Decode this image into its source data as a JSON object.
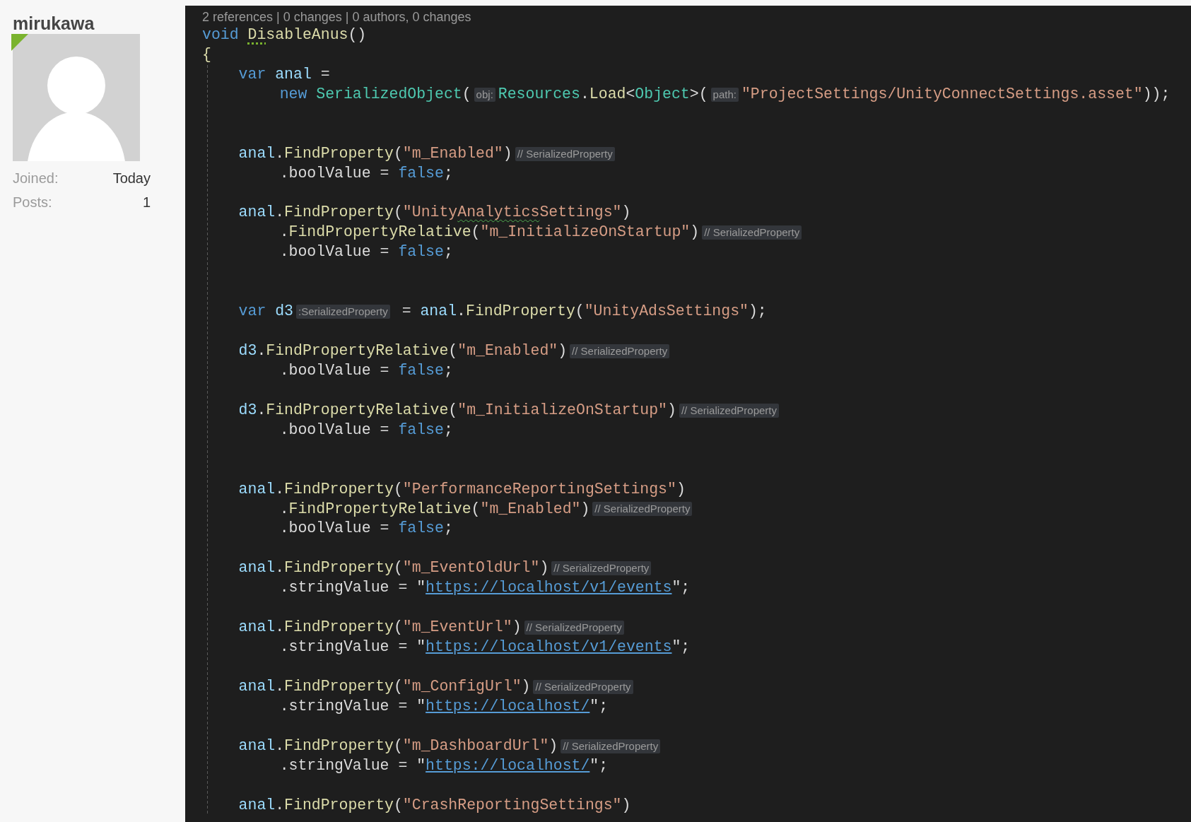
{
  "user": {
    "name": "mirukawa",
    "online": true,
    "stats": [
      {
        "label": "Joined:",
        "value": "Today"
      },
      {
        "label": "Posts:",
        "value": "1"
      }
    ]
  },
  "code": {
    "codelens": "2 references | 0 changes | 0 authors, 0 changes",
    "lines": [
      {
        "kind": "top",
        "segments": [
          {
            "kind": "code",
            "tokens": [
              {
                "kind": "keyword",
                "text": "void "
              },
              {
                "kind": "method",
                "text": "Di",
                "suggestion": true
              },
              {
                "kind": "method",
                "text": "sableAnus"
              },
              {
                "kind": "punct",
                "text": "()"
              }
            ]
          }
        ]
      },
      {
        "kind": "top",
        "segments": [
          {
            "kind": "code",
            "tokens": [
              {
                "kind": "method",
                "text": "{"
              }
            ]
          }
        ]
      },
      {
        "kind": "statement",
        "segments": [
          {
            "kind": "code",
            "tokens": [
              {
                "kind": "keyword",
                "text": "var "
              },
              {
                "kind": "variable",
                "text": "anal"
              },
              {
                "kind": "punct",
                "text": " ="
              }
            ]
          }
        ]
      },
      {
        "kind": "continuation",
        "segments": [
          {
            "kind": "code",
            "tokens": [
              {
                "kind": "keyword",
                "text": "new "
              },
              {
                "kind": "type",
                "text": "SerializedObject"
              },
              {
                "kind": "punct",
                "text": "("
              }
            ]
          },
          {
            "kind": "hint",
            "text": "obj:"
          },
          {
            "kind": "code",
            "tokens": [
              {
                "kind": "type",
                "text": "Resources"
              },
              {
                "kind": "punct",
                "text": "."
              },
              {
                "kind": "method",
                "text": "Load"
              },
              {
                "kind": "punct",
                "text": "<"
              },
              {
                "kind": "type",
                "text": "Object"
              },
              {
                "kind": "punct",
                "text": ">("
              }
            ]
          },
          {
            "kind": "hint",
            "text": "path:"
          },
          {
            "kind": "code",
            "tokens": [
              {
                "kind": "string",
                "text": "\"ProjectSettings/UnityConnectSettings.asset\""
              },
              {
                "kind": "punct",
                "text": "));"
              }
            ]
          }
        ]
      },
      {
        "kind": "blank"
      },
      {
        "kind": "blank"
      },
      {
        "kind": "statement",
        "segments": [
          {
            "kind": "code",
            "tokens": [
              {
                "kind": "variable",
                "text": "anal"
              },
              {
                "kind": "punct",
                "text": "."
              },
              {
                "kind": "method",
                "text": "FindProperty"
              },
              {
                "kind": "punct",
                "text": "("
              },
              {
                "kind": "string",
                "text": "\"m_Enabled\""
              },
              {
                "kind": "punct",
                "text": ")"
              }
            ]
          },
          {
            "kind": "hint",
            "text": "// SerializedProperty"
          }
        ]
      },
      {
        "kind": "continuation",
        "segments": [
          {
            "kind": "code",
            "tokens": [
              {
                "kind": "punct",
                "text": ".boolValue = "
              },
              {
                "kind": "keyword",
                "text": "false"
              },
              {
                "kind": "punct",
                "text": ";"
              }
            ]
          }
        ]
      },
      {
        "kind": "blank"
      },
      {
        "kind": "statement",
        "segments": [
          {
            "kind": "code",
            "tokens": [
              {
                "kind": "variable",
                "text": "anal"
              },
              {
                "kind": "punct",
                "text": "."
              },
              {
                "kind": "method",
                "text": "FindProperty"
              },
              {
                "kind": "punct",
                "text": "("
              },
              {
                "kind": "string",
                "text": "\"Unity"
              },
              {
                "kind": "string",
                "text": "Analytics",
                "warning": true
              },
              {
                "kind": "string",
                "text": "Settings\""
              },
              {
                "kind": "punct",
                "text": ")"
              }
            ]
          }
        ]
      },
      {
        "kind": "continuation",
        "segments": [
          {
            "kind": "code",
            "tokens": [
              {
                "kind": "punct",
                "text": "."
              },
              {
                "kind": "method",
                "text": "FindPropertyRelative"
              },
              {
                "kind": "punct",
                "text": "("
              },
              {
                "kind": "string",
                "text": "\"m_InitializeOnStartup\""
              },
              {
                "kind": "punct",
                "text": ")"
              }
            ]
          },
          {
            "kind": "hint",
            "text": "// SerializedProperty"
          }
        ]
      },
      {
        "kind": "continuation",
        "segments": [
          {
            "kind": "code",
            "tokens": [
              {
                "kind": "punct",
                "text": ".boolValue = "
              },
              {
                "kind": "keyword",
                "text": "false"
              },
              {
                "kind": "punct",
                "text": ";"
              }
            ]
          }
        ]
      },
      {
        "kind": "blank"
      },
      {
        "kind": "blank"
      },
      {
        "kind": "statement",
        "segments": [
          {
            "kind": "code",
            "tokens": [
              {
                "kind": "keyword",
                "text": "var "
              },
              {
                "kind": "variable",
                "text": "d3"
              }
            ]
          },
          {
            "kind": "hint",
            "text": ":SerializedProperty"
          },
          {
            "kind": "code",
            "tokens": [
              {
                "kind": "punct",
                "text": " = "
              },
              {
                "kind": "variable",
                "text": "anal"
              },
              {
                "kind": "punct",
                "text": "."
              },
              {
                "kind": "method",
                "text": "FindProperty"
              },
              {
                "kind": "punct",
                "text": "("
              },
              {
                "kind": "string",
                "text": "\"UnityAdsSettings\""
              },
              {
                "kind": "punct",
                "text": ");"
              }
            ]
          }
        ]
      },
      {
        "kind": "blank"
      },
      {
        "kind": "statement",
        "segments": [
          {
            "kind": "code",
            "tokens": [
              {
                "kind": "variable",
                "text": "d3"
              },
              {
                "kind": "punct",
                "text": "."
              },
              {
                "kind": "method",
                "text": "FindPropertyRelative"
              },
              {
                "kind": "punct",
                "text": "("
              },
              {
                "kind": "string",
                "text": "\"m_Enabled\""
              },
              {
                "kind": "punct",
                "text": ")"
              }
            ]
          },
          {
            "kind": "hint",
            "text": "// SerializedProperty"
          }
        ]
      },
      {
        "kind": "continuation",
        "segments": [
          {
            "kind": "code",
            "tokens": [
              {
                "kind": "punct",
                "text": ".boolValue = "
              },
              {
                "kind": "keyword",
                "text": "false"
              },
              {
                "kind": "punct",
                "text": ";"
              }
            ]
          }
        ]
      },
      {
        "kind": "blank"
      },
      {
        "kind": "statement",
        "segments": [
          {
            "kind": "code",
            "tokens": [
              {
                "kind": "variable",
                "text": "d3"
              },
              {
                "kind": "punct",
                "text": "."
              },
              {
                "kind": "method",
                "text": "FindPropertyRelative"
              },
              {
                "kind": "punct",
                "text": "("
              },
              {
                "kind": "string",
                "text": "\"m_InitializeOnStartup\""
              },
              {
                "kind": "punct",
                "text": ")"
              }
            ]
          },
          {
            "kind": "hint",
            "text": "// SerializedProperty"
          }
        ]
      },
      {
        "kind": "continuation",
        "segments": [
          {
            "kind": "code",
            "tokens": [
              {
                "kind": "punct",
                "text": ".boolValue = "
              },
              {
                "kind": "keyword",
                "text": "false"
              },
              {
                "kind": "punct",
                "text": ";"
              }
            ]
          }
        ]
      },
      {
        "kind": "blank"
      },
      {
        "kind": "blank"
      },
      {
        "kind": "statement",
        "segments": [
          {
            "kind": "code",
            "tokens": [
              {
                "kind": "variable",
                "text": "anal"
              },
              {
                "kind": "punct",
                "text": "."
              },
              {
                "kind": "method",
                "text": "FindProperty"
              },
              {
                "kind": "punct",
                "text": "("
              },
              {
                "kind": "string",
                "text": "\"PerformanceReportingSettings\""
              },
              {
                "kind": "punct",
                "text": ")"
              }
            ]
          }
        ]
      },
      {
        "kind": "continuation",
        "segments": [
          {
            "kind": "code",
            "tokens": [
              {
                "kind": "punct",
                "text": "."
              },
              {
                "kind": "method",
                "text": "FindPropertyRelative"
              },
              {
                "kind": "punct",
                "text": "("
              },
              {
                "kind": "string",
                "text": "\"m_Enabled\""
              },
              {
                "kind": "punct",
                "text": ")"
              }
            ]
          },
          {
            "kind": "hint",
            "text": "// SerializedProperty"
          }
        ]
      },
      {
        "kind": "continuation",
        "segments": [
          {
            "kind": "code",
            "tokens": [
              {
                "kind": "punct",
                "text": ".boolValue = "
              },
              {
                "kind": "keyword",
                "text": "false"
              },
              {
                "kind": "punct",
                "text": ";"
              }
            ]
          }
        ]
      },
      {
        "kind": "blank"
      },
      {
        "kind": "statement",
        "segments": [
          {
            "kind": "code",
            "tokens": [
              {
                "kind": "variable",
                "text": "anal"
              },
              {
                "kind": "punct",
                "text": "."
              },
              {
                "kind": "method",
                "text": "FindProperty"
              },
              {
                "kind": "punct",
                "text": "("
              },
              {
                "kind": "string",
                "text": "\"m_EventOldUrl\""
              },
              {
                "kind": "punct",
                "text": ")"
              }
            ]
          },
          {
            "kind": "hint",
            "text": "// SerializedProperty"
          }
        ]
      },
      {
        "kind": "continuation",
        "segments": [
          {
            "kind": "code",
            "tokens": [
              {
                "kind": "punct",
                "text": ".stringValue = \""
              },
              {
                "kind": "link",
                "text": "https://localhost/v1/events"
              },
              {
                "kind": "punct",
                "text": "\";"
              }
            ]
          }
        ]
      },
      {
        "kind": "blank"
      },
      {
        "kind": "statement",
        "segments": [
          {
            "kind": "code",
            "tokens": [
              {
                "kind": "variable",
                "text": "anal"
              },
              {
                "kind": "punct",
                "text": "."
              },
              {
                "kind": "method",
                "text": "FindProperty"
              },
              {
                "kind": "punct",
                "text": "("
              },
              {
                "kind": "string",
                "text": "\"m_EventUrl\""
              },
              {
                "kind": "punct",
                "text": ")"
              }
            ]
          },
          {
            "kind": "hint",
            "text": "// SerializedProperty"
          }
        ]
      },
      {
        "kind": "continuation",
        "segments": [
          {
            "kind": "code",
            "tokens": [
              {
                "kind": "punct",
                "text": ".stringValue = \""
              },
              {
                "kind": "link",
                "text": "https://localhost/v1/events"
              },
              {
                "kind": "punct",
                "text": "\";"
              }
            ]
          }
        ]
      },
      {
        "kind": "blank"
      },
      {
        "kind": "statement",
        "segments": [
          {
            "kind": "code",
            "tokens": [
              {
                "kind": "variable",
                "text": "anal"
              },
              {
                "kind": "punct",
                "text": "."
              },
              {
                "kind": "method",
                "text": "FindProperty"
              },
              {
                "kind": "punct",
                "text": "("
              },
              {
                "kind": "string",
                "text": "\"m_ConfigUrl\""
              },
              {
                "kind": "punct",
                "text": ")"
              }
            ]
          },
          {
            "kind": "hint",
            "text": "// SerializedProperty"
          }
        ]
      },
      {
        "kind": "continuation",
        "segments": [
          {
            "kind": "code",
            "tokens": [
              {
                "kind": "punct",
                "text": ".stringValue = \""
              },
              {
                "kind": "link",
                "text": "https://localhost/"
              },
              {
                "kind": "punct",
                "text": "\";"
              }
            ]
          }
        ]
      },
      {
        "kind": "blank"
      },
      {
        "kind": "statement",
        "segments": [
          {
            "kind": "code",
            "tokens": [
              {
                "kind": "variable",
                "text": "anal"
              },
              {
                "kind": "punct",
                "text": "."
              },
              {
                "kind": "method",
                "text": "FindProperty"
              },
              {
                "kind": "punct",
                "text": "("
              },
              {
                "kind": "string",
                "text": "\"m_DashboardUrl\""
              },
              {
                "kind": "punct",
                "text": ")"
              }
            ]
          },
          {
            "kind": "hint",
            "text": "// SerializedProperty"
          }
        ]
      },
      {
        "kind": "continuation",
        "segments": [
          {
            "kind": "code",
            "tokens": [
              {
                "kind": "punct",
                "text": ".stringValue = \""
              },
              {
                "kind": "link",
                "text": "https://localhost/"
              },
              {
                "kind": "punct",
                "text": "\";"
              }
            ]
          }
        ]
      },
      {
        "kind": "blank"
      },
      {
        "kind": "statement",
        "segments": [
          {
            "kind": "code",
            "tokens": [
              {
                "kind": "variable",
                "text": "anal"
              },
              {
                "kind": "punct",
                "text": "."
              },
              {
                "kind": "method",
                "text": "FindProperty"
              },
              {
                "kind": "punct",
                "text": "("
              },
              {
                "kind": "string",
                "text": "\"CrashReportingSettings\""
              },
              {
                "kind": "punct",
                "text": ")"
              }
            ]
          }
        ]
      }
    ]
  }
}
